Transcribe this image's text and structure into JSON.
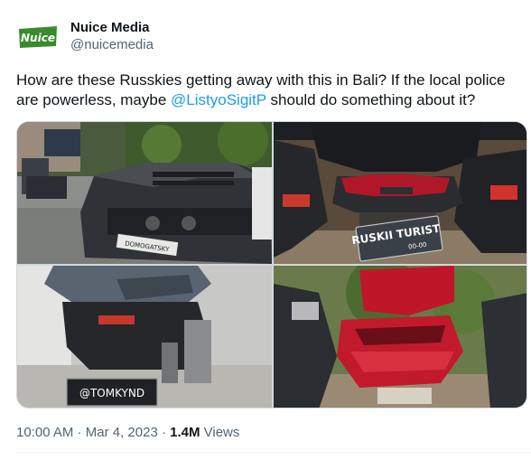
{
  "author": {
    "name": "Nuice Media",
    "handle": "@nuicemedia",
    "avatar_text": "Nuice"
  },
  "tweet": {
    "text_before": "How are these Russkies getting away with this in Bali? If the local police are powerless, maybe ",
    "mention": "@ListyoSigitP",
    "text_after": " should do something about it?"
  },
  "media": [
    {
      "plate_text": "DOMOGATSKY"
    },
    {
      "plate_text": "RUSKII TURIST",
      "plate_sub": "00-00"
    },
    {
      "plate_text": "@TOMKYND"
    },
    {
      "plate_text": ""
    }
  ],
  "meta": {
    "time": "10:00 AM",
    "sep1": " · ",
    "date": "Mar 4, 2023",
    "sep2": " · ",
    "views_count": "1.4M",
    "views_label": " Views"
  },
  "colors": {
    "text": "#0f1419",
    "secondary": "#536471",
    "link": "#1d9bf0",
    "avatar_green": "#3a8a2e"
  }
}
